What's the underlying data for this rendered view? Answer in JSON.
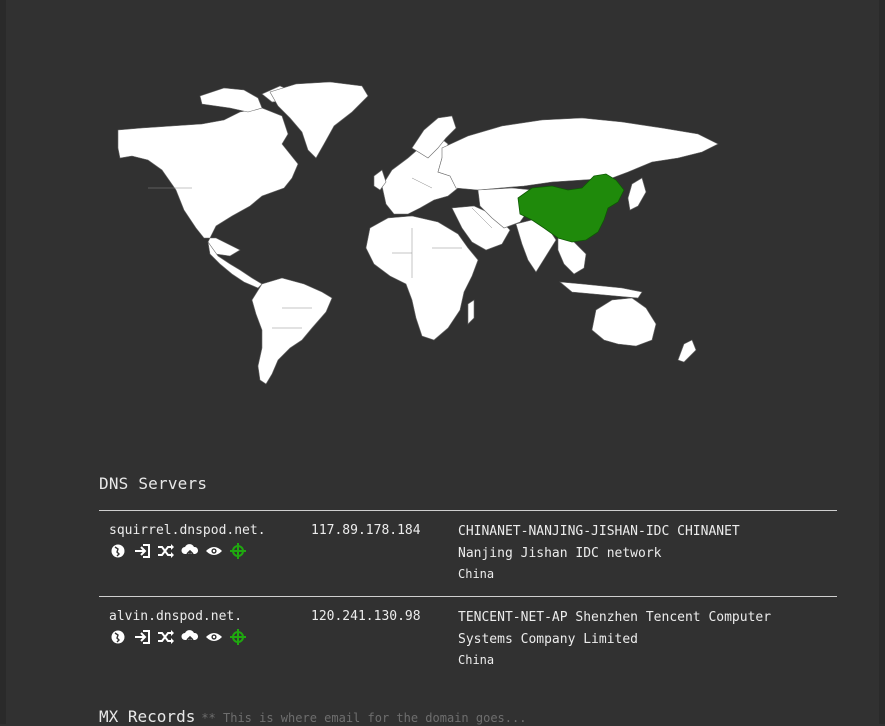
{
  "map": {
    "highlighted_country": "China",
    "highlight_color": "#1f8a0b",
    "land_color": "#ffffff",
    "background_color": "#313131"
  },
  "dns_section": {
    "title": "DNS Servers"
  },
  "dns_servers": [
    {
      "host": "squirrel.dnspod.net.",
      "ip": "117.89.178.184",
      "owner_line1": "CHINANET-NANJING-JISHAN-IDC CHINANET",
      "owner_line2": "Nanjing Jishan IDC network",
      "country": "China",
      "icons": [
        "globe-icon",
        "login-icon",
        "shuffle-icon",
        "cloud-upload-icon",
        "eye-icon",
        "crosshair-icon"
      ]
    },
    {
      "host": "alvin.dnspod.net.",
      "ip": "120.241.130.98",
      "owner_line1": "TENCENT-NET-AP Shenzhen Tencent Computer",
      "owner_line2": "Systems Company Limited",
      "country": "China",
      "icons": [
        "globe-icon",
        "login-icon",
        "shuffle-icon",
        "cloud-upload-icon",
        "eye-icon",
        "crosshair-icon"
      ]
    }
  ],
  "mx_section": {
    "title": "MX Records",
    "note": "** This is where email for the domain goes..."
  }
}
